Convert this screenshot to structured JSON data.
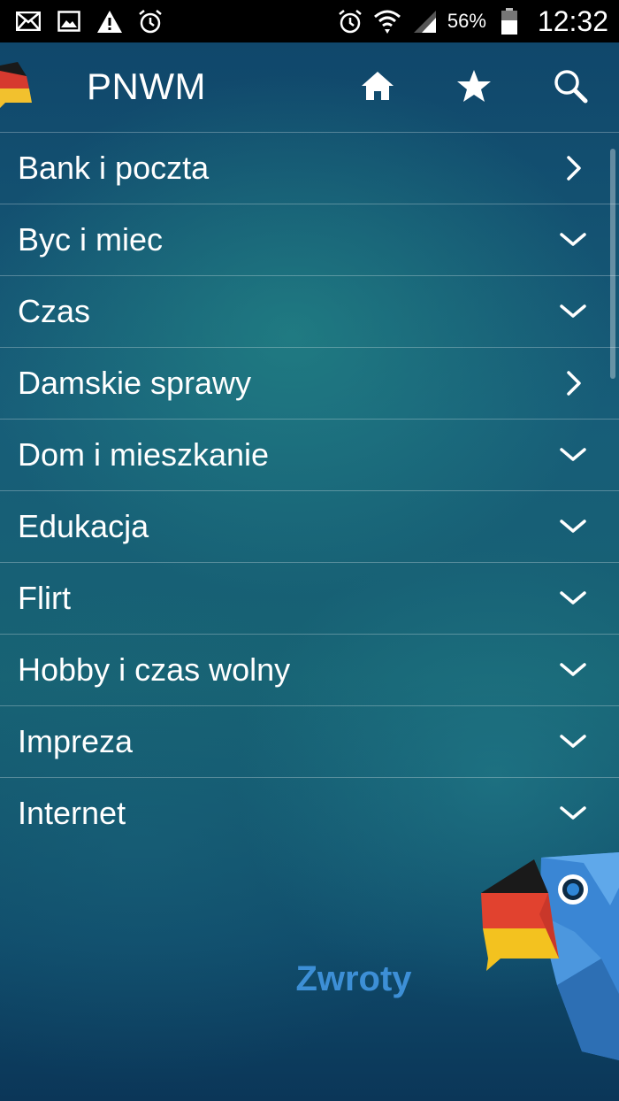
{
  "status_bar": {
    "left_icons": [
      "mail-icon",
      "image-icon",
      "warning-icon",
      "alarm-icon"
    ],
    "right_icons": [
      "alarm-icon",
      "wifi-icon",
      "signal-icon",
      "battery-icon"
    ],
    "battery_percent": "56%",
    "time": "12:32"
  },
  "app_bar": {
    "title": "PNWM",
    "actions": [
      "home-icon",
      "star-icon",
      "search-icon"
    ]
  },
  "categories": [
    {
      "label": "Bank i poczta",
      "icon": "chevron-right-icon"
    },
    {
      "label": "Byc i miec",
      "icon": "chevron-down-icon"
    },
    {
      "label": "Czas",
      "icon": "chevron-down-icon"
    },
    {
      "label": "Damskie sprawy",
      "icon": "chevron-right-icon"
    },
    {
      "label": "Dom i mieszkanie",
      "icon": "chevron-down-icon"
    },
    {
      "label": "Edukacja",
      "icon": "chevron-down-icon"
    },
    {
      "label": "Flirt",
      "icon": "chevron-down-icon"
    },
    {
      "label": "Hobby i czas wolny",
      "icon": "chevron-down-icon"
    },
    {
      "label": "Impreza",
      "icon": "chevron-down-icon"
    },
    {
      "label": "Internet",
      "icon": "chevron-down-icon"
    }
  ],
  "footer": {
    "brand": "Zwroty"
  },
  "colors": {
    "brand_text": "#3d8fd6",
    "status_bar_bg": "#000000",
    "background_dark": "#0e3a57",
    "background_teal": "#1c6e74"
  }
}
